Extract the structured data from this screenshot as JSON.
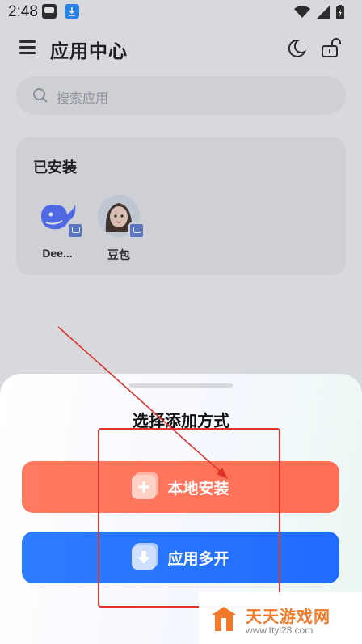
{
  "status_bar": {
    "time": "2:48"
  },
  "header": {
    "title": "应用中心"
  },
  "search": {
    "placeholder": "搜索应用"
  },
  "installed": {
    "title": "已安装",
    "apps": [
      {
        "label": "Dee...",
        "icon": "deepseek-whale-icon"
      },
      {
        "label": "豆包",
        "icon": "doubao-avatar-icon"
      }
    ]
  },
  "sheet": {
    "title": "选择添加方式",
    "local_install_label": "本地安装",
    "multi_open_label": "应用多开"
  },
  "watermark": {
    "brand": "天天游戏网",
    "url": "www.ttyl23.com"
  },
  "colors": {
    "local_button": "#ff7058",
    "multi_button": "#2673ff",
    "annotation": "#e0342c",
    "watermark_brand": "#f17a2a"
  }
}
